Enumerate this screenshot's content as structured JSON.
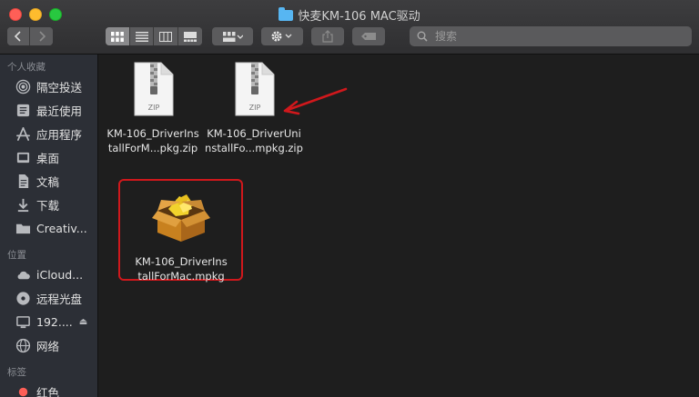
{
  "window": {
    "title": "快麦KM-106 MAC驱动"
  },
  "toolbar": {
    "back_icon": "chevron-left-icon",
    "forward_icon": "chevron-right-icon",
    "views": [
      "icon-view-icon",
      "list-view-icon",
      "column-view-icon",
      "gallery-view-icon"
    ],
    "arrange_icon": "arrange-grid-icon",
    "action_icon": "gear-icon",
    "share_icon": "share-icon",
    "tag_icon": "tag-icon"
  },
  "search": {
    "placeholder": "搜索"
  },
  "sidebar": {
    "favorites_header": "个人收藏",
    "favorites": [
      {
        "label": "隔空投送",
        "icon": "airdrop-icon"
      },
      {
        "label": "最近使用",
        "icon": "recents-icon"
      },
      {
        "label": "应用程序",
        "icon": "applications-icon"
      },
      {
        "label": "桌面",
        "icon": "desktop-icon"
      },
      {
        "label": "文稿",
        "icon": "documents-icon"
      },
      {
        "label": "下载",
        "icon": "downloads-icon"
      },
      {
        "label": "Creativ...",
        "icon": "folder-icon"
      }
    ],
    "locations_header": "位置",
    "locations": [
      {
        "label": "iCloud...",
        "icon": "icloud-icon"
      },
      {
        "label": "远程光盘",
        "icon": "remote-disc-icon"
      },
      {
        "label": "192....",
        "icon": "computer-icon"
      },
      {
        "label": "网络",
        "icon": "network-icon"
      }
    ],
    "tags_header": "标签",
    "tags": [
      {
        "label": "红色",
        "color": "#fe5f57"
      }
    ]
  },
  "files": [
    {
      "line1": "KM-106_DriverIns",
      "line2": "tallForM...pkg.zip",
      "type": "ZIP",
      "icon": "zip-file-icon"
    },
    {
      "line1": "KM-106_DriverUni",
      "line2": "nstallFo...mpkg.zip",
      "type": "ZIP",
      "icon": "zip-file-icon"
    },
    {
      "line1": "KM-106_DriverIns",
      "line2": "tallForMac.mpkg",
      "icon": "package-icon"
    }
  ],
  "colors": {
    "annotation_red": "#d0181c",
    "folder_blue": "#57b6f2"
  }
}
